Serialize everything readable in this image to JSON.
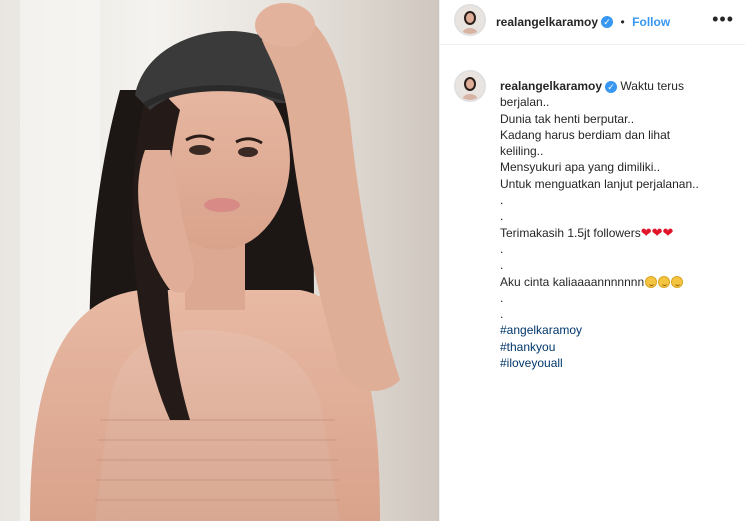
{
  "post": {
    "username": "realangelkaramoy",
    "verified_icon": "verified-check-icon",
    "separator": "•",
    "follow_label": "Follow",
    "more_icon": "more-options-icon",
    "more_glyph": "•••"
  },
  "caption": {
    "username": "realangelkaramoy",
    "first_line": "Waktu terus",
    "lines": [
      "berjalan..",
      "Dunia tak henti berputar..",
      "Kadang harus berdiam dan lihat",
      "keliling..",
      "Mensyukuri apa yang dimiliki..",
      "Untuk menguatkan lanjut perjalanan..",
      ".",
      ".",
      "Terimakasih 1.5jt followers",
      ".",
      ".",
      "Aku cinta kaliaaaannnnnnn",
      ".",
      ".",
      "#angelkaramoy",
      "#thankyou",
      "#iloveyouall"
    ],
    "hearts": "❤❤❤",
    "emoji_names": [
      "red-heart-icon",
      "kissing-face-icon"
    ]
  },
  "colors": {
    "link_blue": "#3897f0",
    "hashtag_blue": "#00376b",
    "text": "#262626"
  }
}
